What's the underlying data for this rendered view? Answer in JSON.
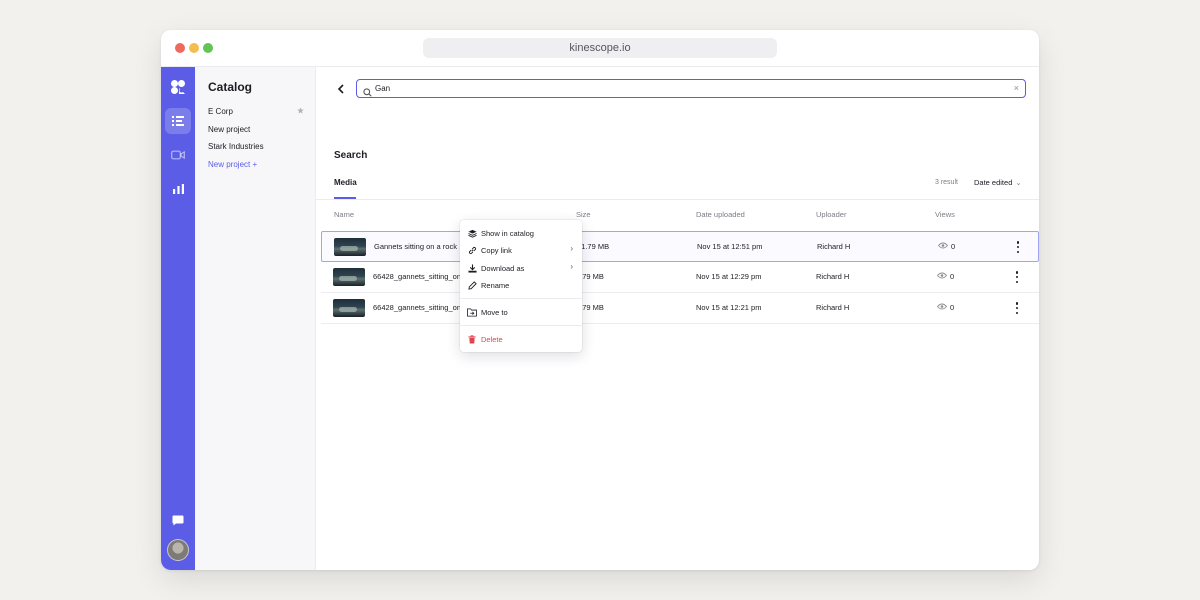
{
  "browser": {
    "url": "kinescope.io"
  },
  "catalog": {
    "title": "Catalog",
    "items": [
      {
        "label": "E Corp"
      },
      {
        "label": "New project"
      },
      {
        "label": "Stark Industries"
      }
    ],
    "new_project": "New project  +"
  },
  "search": {
    "value": "Gan",
    "heading": "Search",
    "clear": "×"
  },
  "tabs": {
    "media": "Media"
  },
  "results": {
    "count": "3 result",
    "sort_label": "Date edited",
    "sort_chevron": "⌄"
  },
  "columns": {
    "name": "Name",
    "size": "Size",
    "date": "Date uploaded",
    "uploader": "Uploader",
    "views": "Views"
  },
  "rows": [
    {
      "name": "Gannets sitting on a rock",
      "size": "31.79 MB",
      "date": "Nov 15 at 12:51 pm",
      "uploader": "Richard H",
      "views": "0"
    },
    {
      "name": "66428_gannets_sitting_on",
      "size": "1.79 MB",
      "date": "Nov 15 at 12:29 pm",
      "uploader": "Richard H",
      "views": "0"
    },
    {
      "name": "66428_gannets_sitting_on",
      "size": "1.79 MB",
      "date": "Nov 15 at 12:21 pm",
      "uploader": "Richard H",
      "views": "0"
    }
  ],
  "context_menu": {
    "show_in_catalog": "Show in catalog",
    "copy_link": "Copy link",
    "download_as": "Download as",
    "rename": "Rename",
    "move_to": "Move to",
    "delete": "Delete",
    "submenu_arrow": "›"
  },
  "icons": {
    "logo": "kinescope-logo-icon",
    "list": "list-icon",
    "video": "video-camera-icon",
    "stats": "bar-chart-icon",
    "chat": "chat-icon",
    "star": "star-icon"
  },
  "colors": {
    "accent": "#5b5de6",
    "danger": "#e0454f"
  }
}
